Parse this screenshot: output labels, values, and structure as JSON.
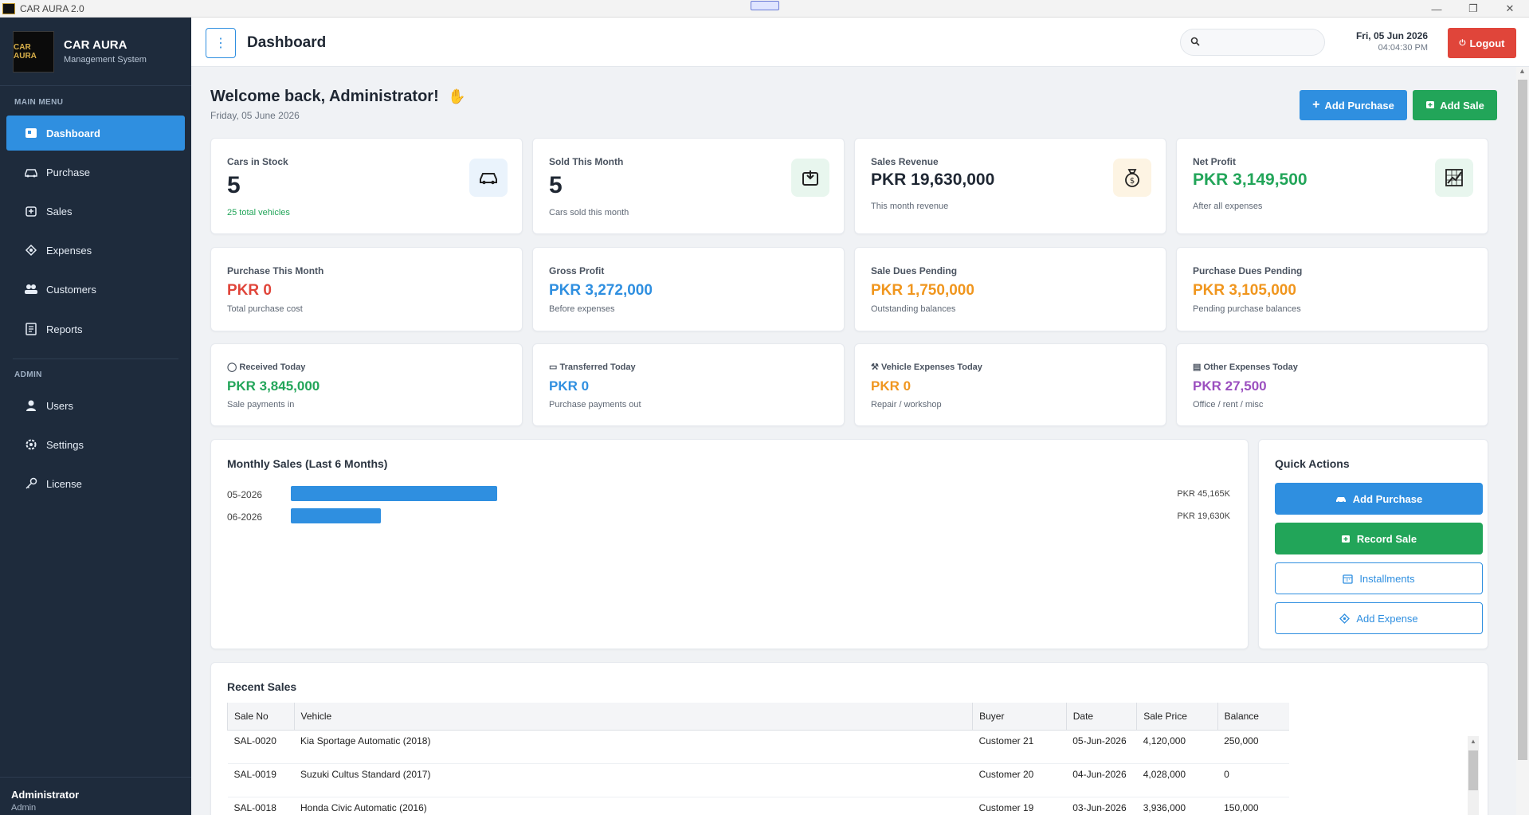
{
  "window": {
    "title": "CAR AURA 2.0"
  },
  "brand": {
    "logo_text": "CAR AURA",
    "name": "CAR AURA",
    "subtitle": "Management System"
  },
  "sidebar": {
    "main_label": "MAIN MENU",
    "admin_label": "ADMIN",
    "items": [
      {
        "label": "Dashboard",
        "icon": "dashboard-icon",
        "active": true
      },
      {
        "label": "Purchase",
        "icon": "car-icon"
      },
      {
        "label": "Sales",
        "icon": "sales-icon"
      },
      {
        "label": "Expenses",
        "icon": "expenses-icon"
      },
      {
        "label": "Customers",
        "icon": "customers-icon"
      },
      {
        "label": "Reports",
        "icon": "reports-icon"
      }
    ],
    "admin_items": [
      {
        "label": "Users",
        "icon": "user-icon"
      },
      {
        "label": "Settings",
        "icon": "gear-icon"
      },
      {
        "label": "License",
        "icon": "key-icon"
      }
    ],
    "footer": {
      "user": "Administrator",
      "role": "Admin"
    }
  },
  "topbar": {
    "title": "Dashboard",
    "search_placeholder": "",
    "date": "Fri, 05 Jun 2026",
    "time": "04:04:30 PM",
    "logout": "Logout"
  },
  "welcome": {
    "heading": "Welcome back, Administrator!",
    "date": "Friday, 05 June 2026",
    "add_purchase": "Add Purchase",
    "add_sale": "Add Sale"
  },
  "stats": [
    {
      "label": "Cars in Stock",
      "value": "5",
      "sub": "25 total vehicles",
      "icon": "car-icon",
      "value_color": "#1f2733",
      "sub_color": "#22a559"
    },
    {
      "label": "Sold This Month",
      "value": "5",
      "sub": "Cars sold this month",
      "icon": "box-icon",
      "value_color": "#1f2733",
      "sub_color": "#5f6875"
    },
    {
      "label": "Sales Revenue",
      "value": "PKR 19,630,000",
      "sub": "This month revenue",
      "icon": "money-bag-icon",
      "value_color": "#1f2733",
      "sub_color": "#5f6875"
    },
    {
      "label": "Net Profit",
      "value": "PKR 3,149,500",
      "sub": "After all expenses",
      "icon": "chart-icon",
      "value_color": "#22a559",
      "sub_color": "#5f6875"
    }
  ],
  "stats2": [
    {
      "label": "Purchase This Month",
      "value": "PKR 0",
      "sub": "Total purchase cost",
      "value_color": "#e0453a"
    },
    {
      "label": "Gross Profit",
      "value": "PKR 3,272,000",
      "sub": "Before expenses",
      "value_color": "#2f8fe0"
    },
    {
      "label": "Sale Dues Pending",
      "value": "PKR 1,750,000",
      "sub": "Outstanding balances",
      "value_color": "#f0961e"
    },
    {
      "label": "Purchase Dues Pending",
      "value": "PKR 3,105,000",
      "sub": "Pending purchase balances",
      "value_color": "#f0961e"
    }
  ],
  "stats3": [
    {
      "label": "Received Today",
      "value": "PKR 3,845,000",
      "sub": "Sale payments in",
      "icon": "money-bag-icon",
      "value_color": "#22a559"
    },
    {
      "label": "Transferred Today",
      "value": "PKR 0",
      "sub": "Purchase payments out",
      "icon": "card-icon",
      "value_color": "#2f8fe0"
    },
    {
      "label": "Vehicle Expenses Today",
      "value": "PKR 0",
      "sub": "Repair / workshop",
      "icon": "wrench-icon",
      "value_color": "#f0961e"
    },
    {
      "label": "Other Expenses Today",
      "value": "PKR 27,500",
      "sub": "Office / rent / misc",
      "icon": "receipt-icon",
      "value_color": "#9b4fbf"
    }
  ],
  "monthly_sales": {
    "title": "Monthly Sales (Last 6 Months)",
    "rows": [
      {
        "label": "05-2026",
        "display": "PKR 45,165K"
      },
      {
        "label": "06-2026",
        "display": "PKR 19,630K"
      }
    ]
  },
  "chart_data": {
    "type": "bar",
    "title": "Monthly Sales (Last 6 Months)",
    "categories": [
      "05-2026",
      "06-2026"
    ],
    "values": [
      45165,
      19630
    ],
    "unit": "PKR K"
  },
  "quick_actions": {
    "title": "Quick Actions",
    "add_purchase": "Add Purchase",
    "record_sale": "Record Sale",
    "installments": "Installments",
    "add_expense": "Add Expense"
  },
  "recent_sales": {
    "title": "Recent Sales",
    "columns": [
      "Sale No",
      "Vehicle",
      "Buyer",
      "Date",
      "Sale Price",
      "Balance"
    ],
    "rows": [
      [
        "SAL-0020",
        "Kia Sportage Automatic (2018)",
        "Customer 21",
        "05-Jun-2026",
        "4,120,000",
        "250,000"
      ],
      [
        "SAL-0019",
        "Suzuki Cultus Standard (2017)",
        "Customer 20",
        "04-Jun-2026",
        "4,028,000",
        "0"
      ],
      [
        "SAL-0018",
        "Honda Civic Automatic (2016)",
        "Customer 19",
        "03-Jun-2026",
        "3,936,000",
        "150,000"
      ]
    ]
  },
  "colors": {
    "primary": "#2f8fe0",
    "success": "#22a559",
    "danger": "#e0453a",
    "sidebar": "#1e2b3c"
  }
}
